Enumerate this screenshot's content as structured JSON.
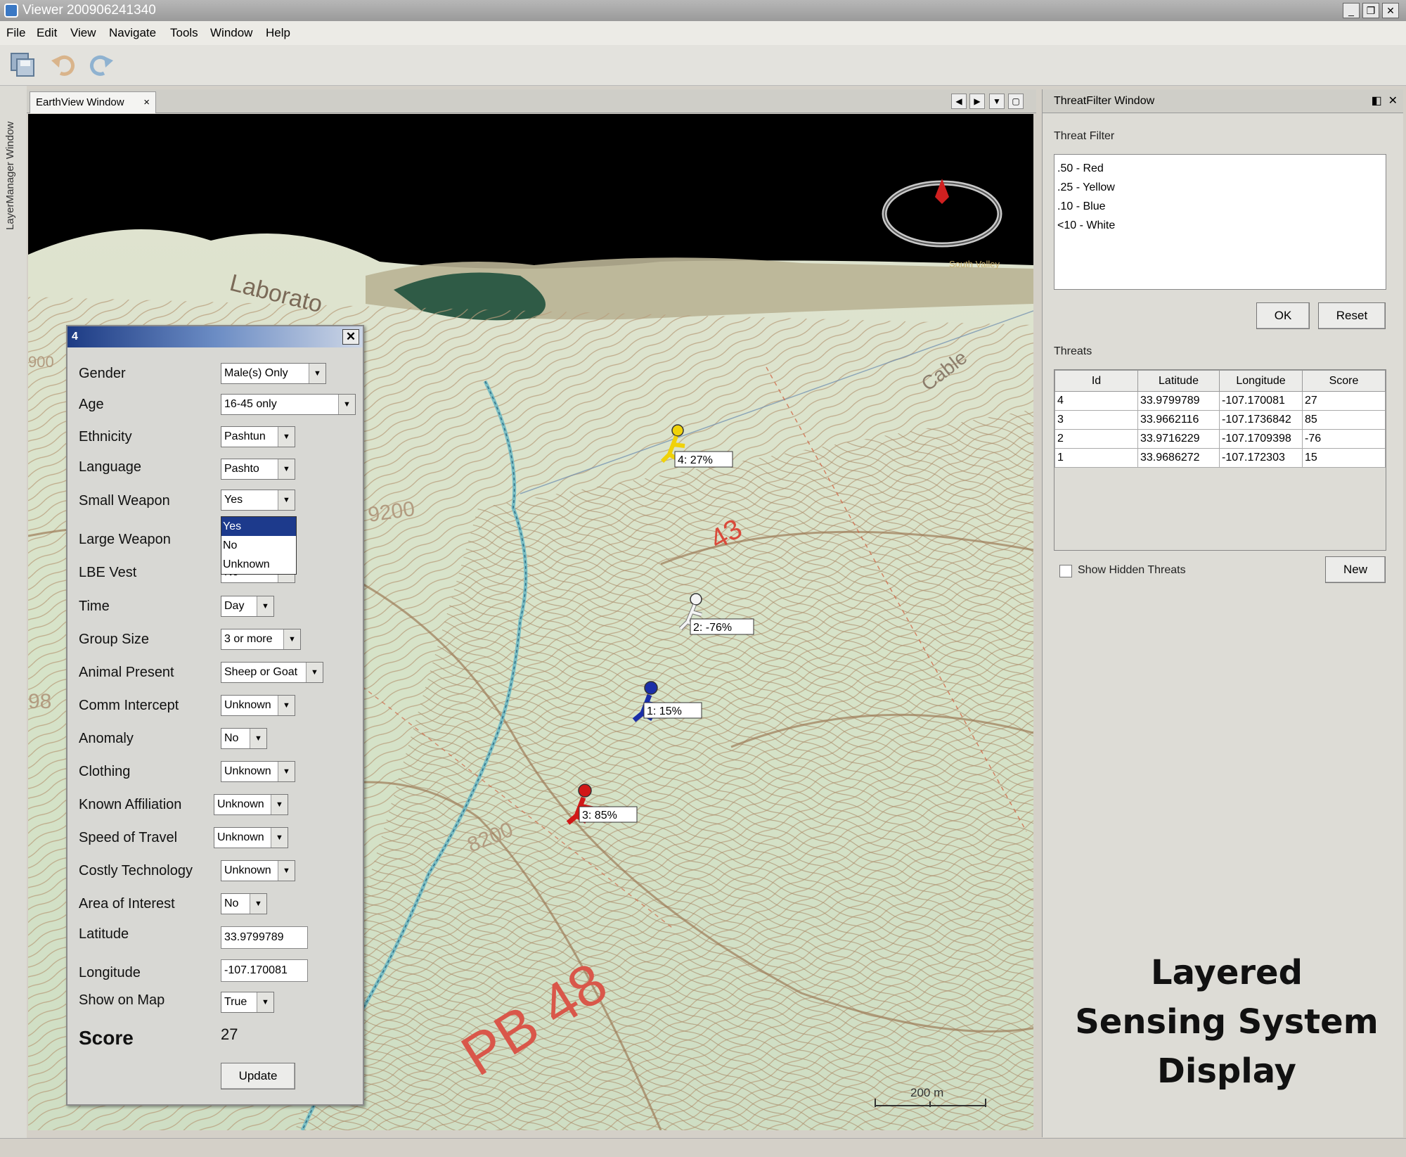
{
  "window": {
    "title": "Viewer 200906241340",
    "minimize": "_",
    "restore": "❐",
    "close": "✕"
  },
  "menu": [
    "File",
    "Edit",
    "View",
    "Navigate",
    "Tools",
    "Window",
    "Help"
  ],
  "left_strip": {
    "label": "LayerManager Window"
  },
  "earthview": {
    "tab_label": "EarthView Window",
    "tab_close": "×",
    "map_labels": {
      "laboratory": "Laborato",
      "south_valley": "South Valley",
      "contour_9200": "9200",
      "contour_8200": "8200",
      "contour_43": "43",
      "pb48": "PB 48",
      "cable": "Cable",
      "contour_900": "900",
      "contour_98": "98",
      "scale": "200 m"
    },
    "markers": [
      {
        "label": "4: 27%",
        "color": "#f0d20a"
      },
      {
        "label": "2: -76%",
        "color": "#f4f4f4"
      },
      {
        "label": "1: 15%",
        "color": "#1a2ea8"
      },
      {
        "label": "3: 85%",
        "color": "#d11717"
      }
    ]
  },
  "dialog": {
    "title": "4",
    "close": "✕",
    "fields": {
      "gender": {
        "label": "Gender",
        "value": "Male(s) Only"
      },
      "age": {
        "label": "Age",
        "value": "16-45 only"
      },
      "ethnicity": {
        "label": "Ethnicity",
        "value": "Pashtun"
      },
      "language": {
        "label": "Language",
        "value": "Pashto"
      },
      "small_weapon": {
        "label": "Small Weapon",
        "value": "Yes"
      },
      "large_weapon": {
        "label": "Large Weapon",
        "value": ""
      },
      "lbe_vest": {
        "label": "LBE Vest",
        "value": "No"
      },
      "time": {
        "label": "Time",
        "value": "Day"
      },
      "group_size": {
        "label": "Group Size",
        "value": "3 or more"
      },
      "animal_present": {
        "label": "Animal Present",
        "value": "Sheep or Goat"
      },
      "comm_intercept": {
        "label": "Comm Intercept",
        "value": "Unknown"
      },
      "anomaly": {
        "label": "Anomaly",
        "value": "No"
      },
      "clothing": {
        "label": "Clothing",
        "value": "Unknown"
      },
      "known_affiliation": {
        "label": "Known Affiliation",
        "value": "Unknown"
      },
      "speed_of_travel": {
        "label": "Speed of Travel",
        "value": "Unknown"
      },
      "costly_technology": {
        "label": "Costly Technology",
        "value": "Unknown"
      },
      "area_of_interest": {
        "label": "Area of Interest",
        "value": "No"
      },
      "latitude": {
        "label": "Latitude",
        "value": "33.9799789"
      },
      "longitude": {
        "label": "Longitude",
        "value": "-107.170081"
      },
      "show_on_map": {
        "label": "Show on Map",
        "value": "True"
      }
    },
    "dropdown_options": [
      "Yes",
      "No",
      "Unknown"
    ],
    "score_label": "Score",
    "score_value": "27",
    "update_label": "Update"
  },
  "threat_panel": {
    "title": "ThreatFilter Window",
    "filter_label": "Threat Filter",
    "filters": [
      ".50 - Red",
      ".25 - Yellow",
      ".10 - Blue",
      "<10 - White"
    ],
    "ok_label": "OK",
    "reset_label": "Reset",
    "threats_label": "Threats",
    "columns": [
      "Id",
      "Latitude",
      "Longitude",
      "Score"
    ],
    "rows": [
      [
        "4",
        "33.9799789",
        "-107.170081",
        "27"
      ],
      [
        "3",
        "33.9662116",
        "-107.1736842",
        "85"
      ],
      [
        "2",
        "33.9716229",
        "-107.1709398",
        "-76"
      ],
      [
        "1",
        "33.9686272",
        "-107.172303",
        "15"
      ]
    ],
    "show_hidden_label": "Show Hidden Threats",
    "new_label": "New"
  },
  "caption": {
    "line1": "Layered",
    "line2": "Sensing System",
    "line3": "Display"
  }
}
